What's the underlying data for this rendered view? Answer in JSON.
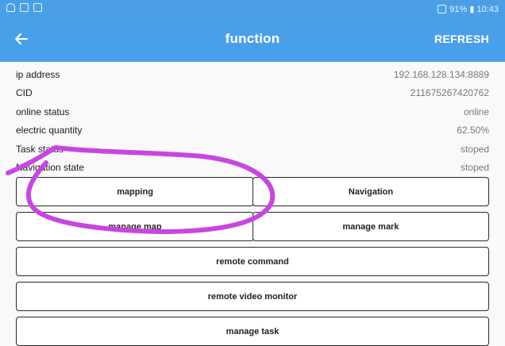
{
  "statusbar": {
    "left_icons": [
      "wifi-icon",
      "image-icon",
      "gallery-icon"
    ],
    "right_text": "91% ▮ 10:43"
  },
  "appbar": {
    "back_icon": "arrow-left-icon",
    "title": "function",
    "refresh": "REFRESH"
  },
  "info": [
    {
      "label": "ip address",
      "value": "192.168.128.134:8889"
    },
    {
      "label": "CID",
      "value": "211675267420762"
    },
    {
      "label": "online status",
      "value": "online"
    },
    {
      "label": "electric quantity",
      "value": "62.50%"
    },
    {
      "label": "Task status",
      "value": "stoped"
    },
    {
      "label": "Navigation state",
      "value": "stoped"
    }
  ],
  "buttons": {
    "mapping": "mapping",
    "navigation": "Navigation",
    "manage_map": "manage map",
    "manage_mark": "manage mark",
    "remote_command": "remote command",
    "remote_video_monitor": "remote video monitor",
    "manage_task": "manage task"
  },
  "colors": {
    "statusbar": "#4a9fe6",
    "appbar": "#4aa0e8",
    "annotation": "#c746e0"
  }
}
